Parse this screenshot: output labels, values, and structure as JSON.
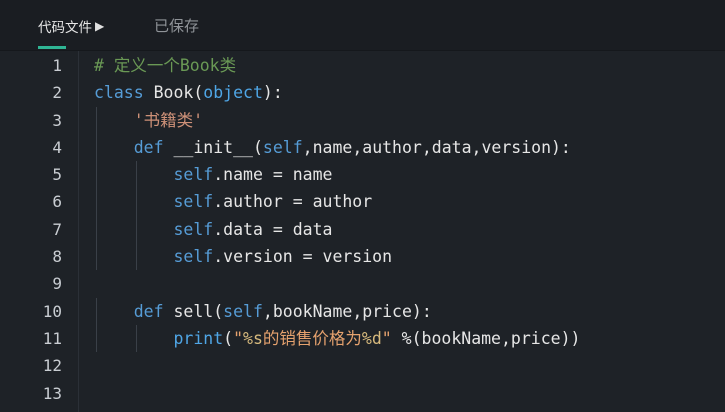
{
  "tab": {
    "label": "代码文件",
    "arrow": "▶",
    "status": "已保存"
  },
  "colors": {
    "keyword": "#569cd6",
    "string": "#ce9178",
    "comment": "#6a9955",
    "accent": "#2fb594",
    "background": "#1e2227"
  },
  "editor": {
    "lines": [
      {
        "num": "1",
        "tokens": [
          {
            "t": "# 定义一个Book类",
            "c": "cm"
          }
        ]
      },
      {
        "num": "2",
        "tokens": [
          {
            "t": "class",
            "c": "kw"
          },
          {
            "t": " Book(",
            "c": "pl"
          },
          {
            "t": "object",
            "c": "bi"
          },
          {
            "t": "):",
            "c": "pl"
          }
        ]
      },
      {
        "num": "3",
        "tokens": [
          {
            "t": "    ",
            "c": "pl"
          },
          {
            "t": "'书籍类'",
            "c": "str"
          }
        ]
      },
      {
        "num": "4",
        "tokens": [
          {
            "t": "    ",
            "c": "pl"
          },
          {
            "t": "def",
            "c": "kw"
          },
          {
            "t": " __init__(",
            "c": "pl"
          },
          {
            "t": "self",
            "c": "kw"
          },
          {
            "t": ",name,author,data,version):",
            "c": "pl"
          }
        ]
      },
      {
        "num": "5",
        "tokens": [
          {
            "t": "        ",
            "c": "pl"
          },
          {
            "t": "self",
            "c": "kw"
          },
          {
            "t": ".name = name",
            "c": "pl"
          }
        ]
      },
      {
        "num": "6",
        "tokens": [
          {
            "t": "        ",
            "c": "pl"
          },
          {
            "t": "self",
            "c": "kw"
          },
          {
            "t": ".author = author",
            "c": "pl"
          }
        ]
      },
      {
        "num": "7",
        "tokens": [
          {
            "t": "        ",
            "c": "pl"
          },
          {
            "t": "self",
            "c": "kw"
          },
          {
            "t": ".data = data",
            "c": "pl"
          }
        ]
      },
      {
        "num": "8",
        "tokens": [
          {
            "t": "        ",
            "c": "pl"
          },
          {
            "t": "self",
            "c": "kw"
          },
          {
            "t": ".version = version",
            "c": "pl"
          }
        ]
      },
      {
        "num": "9",
        "tokens": []
      },
      {
        "num": "10",
        "tokens": [
          {
            "t": "    ",
            "c": "pl"
          },
          {
            "t": "def",
            "c": "kw"
          },
          {
            "t": " sell(",
            "c": "pl"
          },
          {
            "t": "self",
            "c": "kw"
          },
          {
            "t": ",bookName,price):",
            "c": "pl"
          }
        ]
      },
      {
        "num": "11",
        "tokens": [
          {
            "t": "        ",
            "c": "pl"
          },
          {
            "t": "print",
            "c": "bi"
          },
          {
            "t": "(",
            "c": "pl"
          },
          {
            "t": "\"",
            "c": "strm"
          },
          {
            "t": "%s",
            "c": "fmt"
          },
          {
            "t": "的销售价格为",
            "c": "strm"
          },
          {
            "t": "%d",
            "c": "fmt"
          },
          {
            "t": "\"",
            "c": "strm"
          },
          {
            "t": " %(bookName,price))",
            "c": "pl"
          }
        ]
      },
      {
        "num": "12",
        "tokens": []
      },
      {
        "num": "13",
        "tokens": []
      }
    ]
  }
}
